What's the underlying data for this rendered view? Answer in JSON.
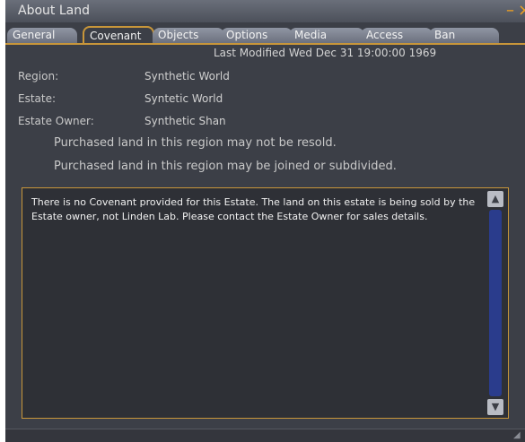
{
  "window": {
    "title": "About Land"
  },
  "tabs": [
    {
      "label": "General"
    },
    {
      "label": "Covenant"
    },
    {
      "label": "Objects"
    },
    {
      "label": "Options"
    },
    {
      "label": "Media"
    },
    {
      "label": "Access"
    },
    {
      "label": "Ban"
    }
  ],
  "active_tab": "Covenant",
  "covenant": {
    "last_modified": "Last Modified Wed Dec 31 19:00:00 1969",
    "region_label": "Region:",
    "region_value": "Synthetic World",
    "estate_label": "Estate:",
    "estate_value": "Syntetic World",
    "owner_label": "Estate Owner:",
    "owner_value": "Synthetic Shan",
    "resale_notice": "Purchased land in this region may not be resold.",
    "subdivide_notice": "Purchased land in this region may be joined or subdivided.",
    "text": "There is no Covenant provided for this Estate. The land on this estate is being sold by the Estate owner, not Linden Lab.  Please contact the Estate Owner for sales details."
  },
  "colors": {
    "accent": "#c8963a",
    "window_bg": "#3c3f47",
    "scroll_track": "#2a3c8c"
  },
  "icons": {
    "minimize": "minimize-icon",
    "close": "close-icon",
    "scroll_up": "scroll-up-arrow-icon",
    "scroll_down": "scroll-down-arrow-icon"
  }
}
